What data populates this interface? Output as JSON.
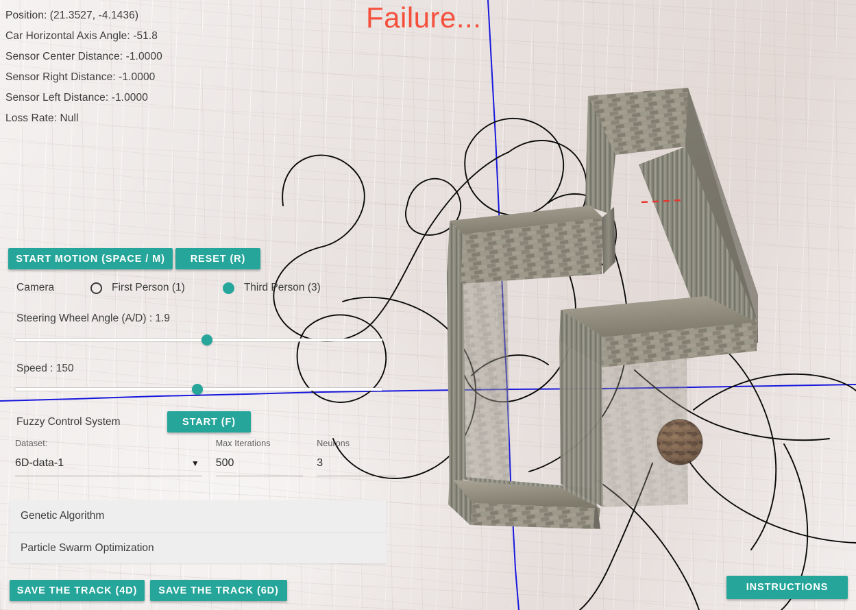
{
  "hud": {
    "status_lines": [
      "Position: (21.3527, -4.1436)",
      "Car Horizontal Axis Angle: -51.8",
      "Sensor Center Distance: -1.0000",
      "Sensor Right Distance: -1.0000",
      "Sensor Left Distance: -1.0000",
      "Loss Rate: Null"
    ],
    "title": "Failure...",
    "title_color": "#f4503c"
  },
  "controls": {
    "start_motion_label": "START MOTION (SPACE / M)",
    "reset_label": "RESET (R)",
    "accent_color": "#26a69a",
    "camera": {
      "label": "Camera",
      "options": [
        {
          "label": "First Person (1)",
          "selected": false
        },
        {
          "label": "Third Person (3)",
          "selected": true
        }
      ]
    },
    "steering": {
      "label": "Steering Wheel Angle (A/D) : 1.9",
      "value": 1.9
    },
    "speed": {
      "label": "Speed : 150",
      "value": 150
    },
    "fuzzy": {
      "label": "Fuzzy Control System",
      "start_label": "START (F)"
    },
    "fields": {
      "dataset": {
        "label": "Dataset:",
        "value": "6D-data-1",
        "caret": "▼"
      },
      "max_iterations": {
        "label": "Max Iterations",
        "value": "500"
      },
      "neurons": {
        "label": "Neurons",
        "value": "3"
      }
    },
    "algorithms": [
      {
        "label": "Genetic Algorithm"
      },
      {
        "label": "Particle Swarm Optimization"
      }
    ],
    "save_track_4d_label": "SAVE THE TRACK (4D)",
    "save_track_6d_label": "SAVE THE TRACK (6D)",
    "instructions_label": "INSTRUCTIONS"
  },
  "scene": {
    "axis_color": "#1818dd",
    "trail_color": "#000000",
    "finish_line_color": "#e8342a",
    "wall_color": "#8d897c",
    "car_color": "#7a6352"
  }
}
